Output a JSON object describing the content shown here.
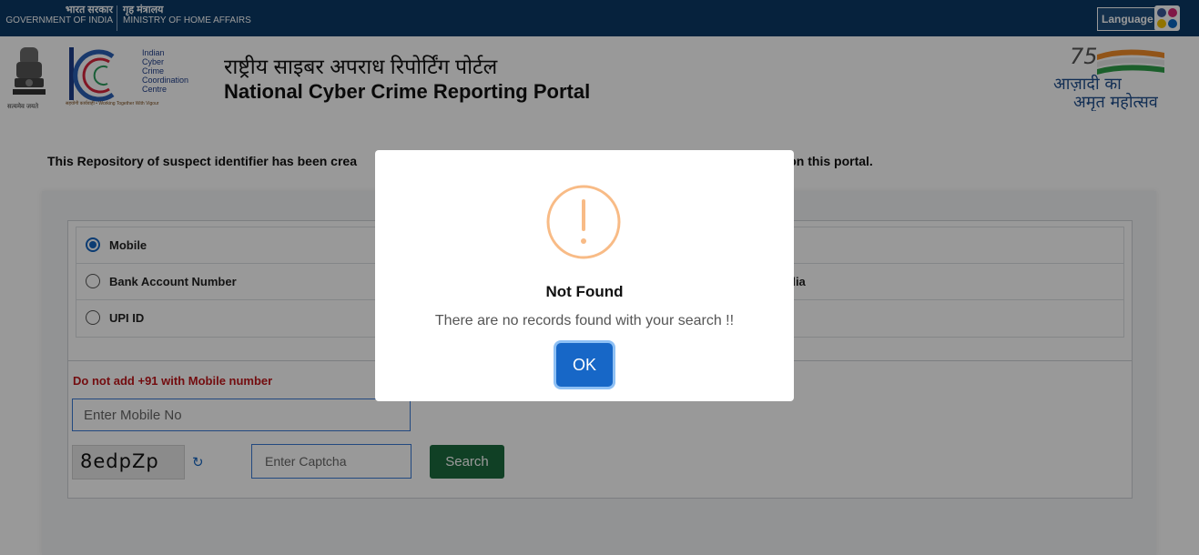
{
  "gov_bar": {
    "gov_hindi": "भारत सरकार",
    "gov_english": "GOVERNMENT OF INDIA",
    "ministry_hindi": "गृह मंत्रालय",
    "ministry_english": "MINISTRY OF HOME AFFAIRS",
    "language_label": "Language"
  },
  "header": {
    "emblem_motto": "सत्यमेव जयते",
    "i4c_words": [
      "Indian",
      "Cyber",
      "Crime",
      "Coordination",
      "Centre"
    ],
    "i4c_tagline": "सहयोगी कार्यवाही • Working Together With Vigour",
    "title_hindi": "राष्ट्रीय साइबर अपराध रिपोर्टिंग पोर्टल",
    "title_english": "National Cyber Crime Reporting Portal",
    "azadi_line1": "आज़ादी का",
    "azadi_line2": "अमृत महोत्सव"
  },
  "intro": {
    "left_text": "This Repository of suspect identifier has been crea",
    "right_text": "ercrimes on this portal."
  },
  "form": {
    "options": [
      {
        "label": "Mobile",
        "selected": true,
        "right_label": ""
      },
      {
        "label": "Bank Account Number",
        "selected": false,
        "right_label": "dia"
      },
      {
        "label": "UPI ID",
        "selected": false,
        "right_label": ""
      }
    ],
    "warning": "Do not add +91 with Mobile number",
    "mobile_placeholder": "Enter Mobile No",
    "captcha_text": "8edpZp",
    "captcha_placeholder": "Enter Captcha",
    "search_label": "Search"
  },
  "modal": {
    "title": "Not Found",
    "message": "There are no records found with your search !!",
    "ok_label": "OK",
    "icon": "warning-icon",
    "icon_color": "#f8bb86"
  },
  "colors": {
    "gov_bar": "#0b3a66",
    "search_button": "#1c6b3e",
    "ok_button": "#1767c7",
    "warning_text": "#c0171b"
  }
}
